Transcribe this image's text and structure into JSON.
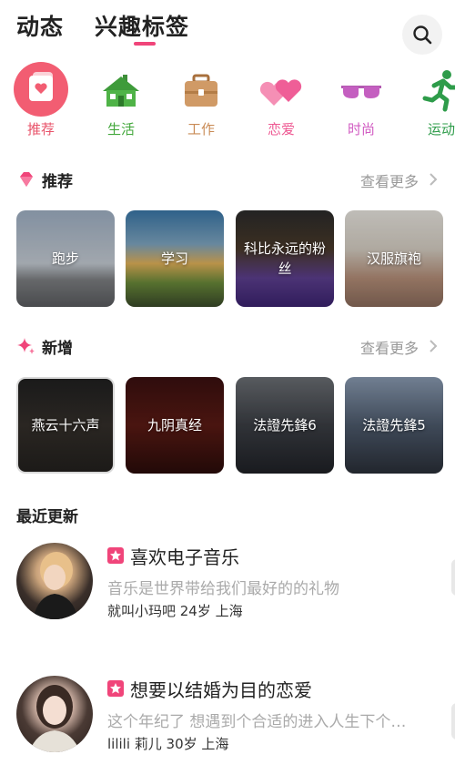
{
  "header": {
    "tab_1": "动态",
    "tab_2": "兴趣标签",
    "accent": "#f0457a"
  },
  "categories": [
    {
      "label": "推荐",
      "icon": "recommend-card-icon",
      "color": "#e8536a"
    },
    {
      "label": "生活",
      "icon": "house-icon",
      "color": "#43a83c"
    },
    {
      "label": "工作",
      "icon": "briefcase-icon",
      "color": "#c98b56"
    },
    {
      "label": "恋爱",
      "icon": "hearts-icon",
      "color": "#ee5a93"
    },
    {
      "label": "时尚",
      "icon": "sunglasses-icon",
      "color": "#d15bc2"
    },
    {
      "label": "运动",
      "icon": "runner-icon",
      "color": "#2e9c4a"
    }
  ],
  "recommend": {
    "title": "推荐",
    "more": "查看更多",
    "tiles": [
      {
        "label": "跑步"
      },
      {
        "label": "学习"
      },
      {
        "label": "科比永远的粉丝"
      },
      {
        "label": "汉服旗袍"
      }
    ]
  },
  "new": {
    "title": "新增",
    "more": "查看更多",
    "tiles": [
      {
        "label": "燕云十六声"
      },
      {
        "label": "九阴真经"
      },
      {
        "label": "法證先鋒6"
      },
      {
        "label": "法證先鋒5"
      }
    ]
  },
  "recent": {
    "title": "最近更新",
    "posts": [
      {
        "title": "喜欢电子音乐",
        "desc": "音乐是世界带给我们最好的的礼物",
        "meta": "就叫小玛吧 24岁 上海"
      },
      {
        "title": "想要以结婚为目的恋爱",
        "desc": "这个年纪了 想遇到个合适的进入人生下个…",
        "meta": "lilili 莉儿 30岁 上海"
      }
    ]
  }
}
